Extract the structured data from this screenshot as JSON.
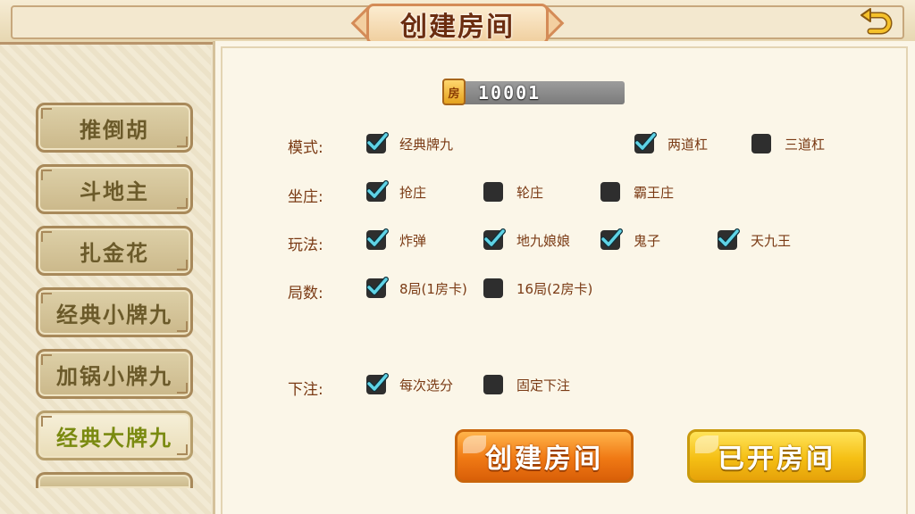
{
  "header": {
    "title": "创建房间"
  },
  "sidebar": {
    "items": [
      {
        "label": "推倒胡"
      },
      {
        "label": "斗地主"
      },
      {
        "label": "扎金花"
      },
      {
        "label": "经典小牌九"
      },
      {
        "label": "加锅小牌九"
      },
      {
        "label": "经典大牌九"
      }
    ],
    "active_index": 5
  },
  "room": {
    "badge": "房",
    "number": "10001"
  },
  "rows": {
    "mode": {
      "label": "模式:",
      "options": [
        {
          "label": "经典牌九",
          "checked": true
        },
        {
          "label": "两道杠",
          "checked": true
        },
        {
          "label": "三道杠",
          "checked": false
        }
      ]
    },
    "banker": {
      "label": "坐庄:",
      "options": [
        {
          "label": "抢庄",
          "checked": true
        },
        {
          "label": "轮庄",
          "checked": false
        },
        {
          "label": "霸王庄",
          "checked": false
        }
      ]
    },
    "play": {
      "label": "玩法:",
      "options": [
        {
          "label": "炸弹",
          "checked": true
        },
        {
          "label": "地九娘娘",
          "checked": true
        },
        {
          "label": "鬼子",
          "checked": true
        },
        {
          "label": "天九王",
          "checked": true
        }
      ]
    },
    "rounds": {
      "label": "局数:",
      "options": [
        {
          "label": "8局(1房卡)",
          "checked": true
        },
        {
          "label": "16局(2房卡)",
          "checked": false
        }
      ]
    },
    "bet": {
      "label": "下注:",
      "options": [
        {
          "label": "每次选分",
          "checked": true
        },
        {
          "label": "固定下注",
          "checked": false
        }
      ]
    }
  },
  "actions": {
    "create": "创建房间",
    "opened": "已开房间"
  },
  "colors": {
    "check_mark": "#5fd3e6",
    "label_text": "#7a3a14",
    "create_button": "#f07914",
    "opened_button": "#f5bf14"
  }
}
